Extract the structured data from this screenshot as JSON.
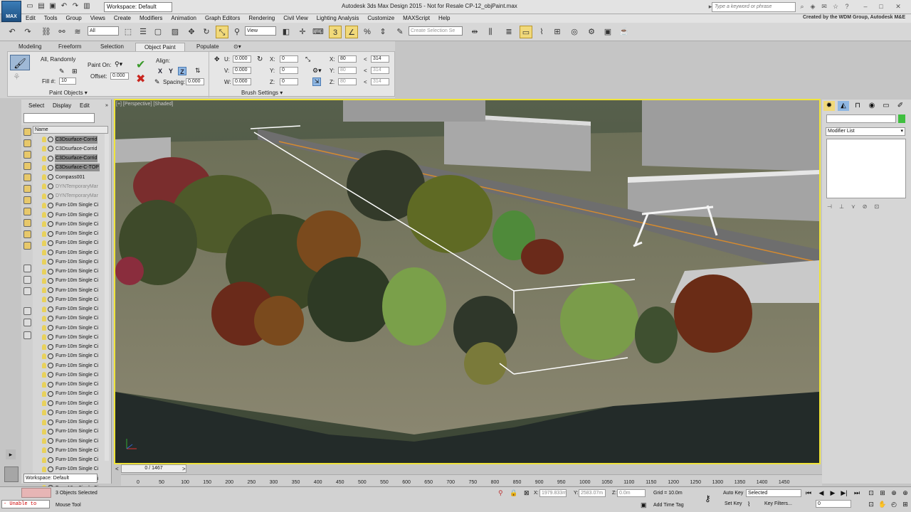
{
  "title_bar": {
    "workspace": "Workspace: Default",
    "app_title": "Autodesk 3ds Max Design 2015 - Not for Resale   CP-12_objPaint.max",
    "search_placeholder": "Type a keyword or phrase",
    "logo_text": "MAX"
  },
  "menu": [
    "Edit",
    "Tools",
    "Group",
    "Views",
    "Create",
    "Modifiers",
    "Animation",
    "Graph Editors",
    "Rendering",
    "Civil View",
    "Lighting Analysis",
    "Customize",
    "MAXScript",
    "Help"
  ],
  "credit": "Created by the WDM Group, Autodesk M&E",
  "toolbar": {
    "filter": "All",
    "ref_coord": "View",
    "selection_set": "Create Selection Se"
  },
  "ribbon": {
    "tabs": [
      "Modeling",
      "Freeform",
      "Selection",
      "Object Paint",
      "Populate"
    ],
    "active_tab": "Object Paint",
    "paint_mode": "All, Randomly",
    "fill_label": "Fill #:",
    "fill_value": "10",
    "paint_on_label": "Paint On:",
    "offset_label": "Offset:",
    "offset_value": "0.000",
    "align_label": "Align:",
    "axes": [
      "X",
      "Y",
      "Z"
    ],
    "active_axis": "Z",
    "spacing_label": "Spacing:",
    "spacing_value": "0.000",
    "u_label": "U:",
    "u_value": "0.000",
    "v_label": "V:",
    "v_value": "0.000",
    "w_label": "W:",
    "w_value": "0.000",
    "rx_label": "X:",
    "rx_value": "0",
    "ry_label": "Y:",
    "ry_value": "0",
    "rz_label": "Z:",
    "rz_value": "0",
    "sx_label": "X:",
    "sx_value": "80",
    "sx2_value": "314",
    "sy_label": "Y:",
    "sy_value": "80",
    "sy2_value": "314",
    "sz_label": "Z:",
    "sz_value": "80",
    "sz2_value": "314",
    "panel1_title": "Paint Objects",
    "panel2_title": "Brush Settings"
  },
  "explorer": {
    "menu": [
      "Select",
      "Display",
      "Edit"
    ],
    "column": "Name",
    "rows": [
      {
        "name": "C3Dsurface-Corrid",
        "selected": true,
        "gray": false
      },
      {
        "name": "C3Dsurface-Corrid",
        "selected": false,
        "gray": false
      },
      {
        "name": "C3Dsurface-Corrid",
        "selected": true,
        "gray": false
      },
      {
        "name": "C3Dsurface-C-TOP",
        "selected": true,
        "gray": false
      },
      {
        "name": "Compass001",
        "selected": false,
        "gray": false
      },
      {
        "name": "DYNTemporaryMar",
        "selected": false,
        "gray": true
      },
      {
        "name": "DYNTemporaryMar",
        "selected": false,
        "gray": true
      },
      {
        "name": "Furn-10m Single Ci",
        "selected": false,
        "gray": false
      },
      {
        "name": "Furn-10m Single Ci",
        "selected": false,
        "gray": false
      },
      {
        "name": "Furn-10m Single Ci",
        "selected": false,
        "gray": false
      },
      {
        "name": "Furn-10m Single Ci",
        "selected": false,
        "gray": false
      },
      {
        "name": "Furn-10m Single Ci",
        "selected": false,
        "gray": false
      },
      {
        "name": "Furn-10m Single Ci",
        "selected": false,
        "gray": false
      },
      {
        "name": "Furn-10m Single Ci",
        "selected": false,
        "gray": false
      },
      {
        "name": "Furn-10m Single Ci",
        "selected": false,
        "gray": false
      },
      {
        "name": "Furn-10m Single Ci",
        "selected": false,
        "gray": false
      },
      {
        "name": "Furn-10m Single Ci",
        "selected": false,
        "gray": false
      },
      {
        "name": "Furn-10m Single Ci",
        "selected": false,
        "gray": false
      },
      {
        "name": "Furn-10m Single Ci",
        "selected": false,
        "gray": false
      },
      {
        "name": "Furn-10m Single Ci",
        "selected": false,
        "gray": false
      },
      {
        "name": "Furn-10m Single Ci",
        "selected": false,
        "gray": false
      },
      {
        "name": "Furn-10m Single Ci",
        "selected": false,
        "gray": false
      },
      {
        "name": "Furn-10m Single Ci",
        "selected": false,
        "gray": false
      },
      {
        "name": "Furn-10m Single Ci",
        "selected": false,
        "gray": false
      },
      {
        "name": "Furn-10m Single Ci",
        "selected": false,
        "gray": false
      },
      {
        "name": "Furn-10m Single Ci",
        "selected": false,
        "gray": false
      },
      {
        "name": "Furn-10m Single Ci",
        "selected": false,
        "gray": false
      },
      {
        "name": "Furn-10m Single Ci",
        "selected": false,
        "gray": false
      },
      {
        "name": "Furn-10m Single Ci",
        "selected": false,
        "gray": false
      },
      {
        "name": "Furn-10m Single Ci",
        "selected": false,
        "gray": false
      },
      {
        "name": "Furn-10m Single Ci",
        "selected": false,
        "gray": false
      },
      {
        "name": "Furn-10m Single Ci",
        "selected": false,
        "gray": false
      },
      {
        "name": "Furn-10m Single Ci",
        "selected": false,
        "gray": false
      },
      {
        "name": "Furn-10m Single Ci",
        "selected": false,
        "gray": false
      },
      {
        "name": "Furn-10m Single Ci",
        "selected": false,
        "gray": false
      },
      {
        "name": "Furn-10m Single Ci",
        "selected": false,
        "gray": false
      },
      {
        "name": "Furn-10m Single Ci",
        "selected": false,
        "gray": false
      },
      {
        "name": "Furn-10m Single Ci",
        "selected": false,
        "gray": false
      }
    ],
    "workspace": "Workspace: Default"
  },
  "viewport": {
    "label": "[+] [Perspective] [Shaded]"
  },
  "command_panel": {
    "modifier_list": "Modifier List"
  },
  "timeline": {
    "frame": "0 / 1467",
    "ticks": [
      "0",
      "50",
      "100",
      "150",
      "200",
      "250",
      "300",
      "350",
      "400",
      "450",
      "500",
      "550",
      "600",
      "650",
      "700",
      "750",
      "800",
      "850",
      "900",
      "950",
      "1000",
      "1050",
      "1100",
      "1150",
      "1200",
      "1250",
      "1300",
      "1350",
      "1400",
      "1450"
    ]
  },
  "status": {
    "maxscript_text": "- Unable to",
    "selection": "3 Objects Selected",
    "prompt": "Mouse Tool",
    "x_label": "X:",
    "x_value": "1979.833m",
    "y_label": "Y:",
    "y_value": "2583.07m",
    "z_label": "Z:",
    "z_value": "0.0m",
    "grid": "Grid = 10.0m",
    "add_time_tag": "Add Time Tag",
    "auto_key": "Auto Key",
    "set_key": "Set Key",
    "key_mode": "Selected",
    "key_filters": "Key Filters...",
    "frame_field": "0"
  },
  "colors": {
    "viewport_border": "#f0e43a",
    "selected_row": "#8e8e8e",
    "active_axis": "#8fb7e3",
    "toolbar_highlight": "#f1d97a"
  }
}
